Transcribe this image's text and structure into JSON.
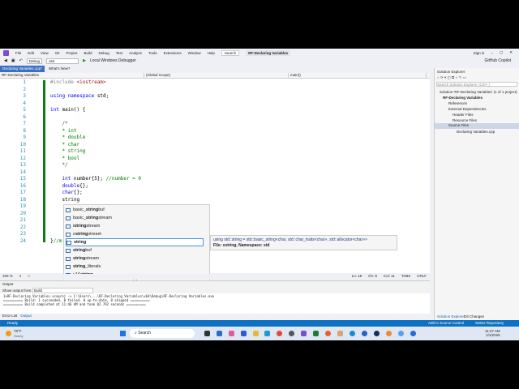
{
  "menu": {
    "items": [
      "File",
      "Edit",
      "View",
      "Git",
      "Project",
      "Build",
      "Debug",
      "Test",
      "Analyze",
      "Tools",
      "Extensions",
      "Window",
      "Help"
    ],
    "search": "Search",
    "project_title": "RF-Declaring Variables",
    "sign_in": "Sign in",
    "copilot": "GitHub Copilot"
  },
  "toolbar": {
    "config": "Debug",
    "platform": "x64",
    "debugger": "Local Windows Debugger"
  },
  "tabs": [
    {
      "label": "Declaring Variables.cpp*"
    },
    {
      "label": "What's New?"
    }
  ],
  "nav": {
    "project": "RF-Declaring Variables",
    "scope": "(Global Scope)",
    "member": "main()"
  },
  "editor": {
    "lines": [
      {
        "n": "1",
        "t": "#include <iostream>"
      },
      {
        "n": "2",
        "t": ""
      },
      {
        "n": "3",
        "t": "using namespace std;"
      },
      {
        "n": "4",
        "t": ""
      },
      {
        "n": "5",
        "t": "int main() {"
      },
      {
        "n": "6",
        "t": ""
      },
      {
        "n": "7",
        "t": "    /*"
      },
      {
        "n": "8",
        "t": "    * int"
      },
      {
        "n": "9",
        "t": "    * double"
      },
      {
        "n": "10",
        "t": "    * char"
      },
      {
        "n": "11",
        "t": "    * string"
      },
      {
        "n": "12",
        "t": "    * bool"
      },
      {
        "n": "13",
        "t": "    */"
      },
      {
        "n": "14",
        "t": ""
      },
      {
        "n": "15",
        "t": "    int number{5}; //number = 0"
      },
      {
        "n": "16",
        "t": "    double{};"
      },
      {
        "n": "17",
        "t": "    char{};"
      },
      {
        "n": "18",
        "t": "    string"
      },
      {
        "n": "19",
        "t": ""
      },
      {
        "n": "20",
        "t": ""
      },
      {
        "n": "21",
        "t": ""
      },
      {
        "n": "22",
        "t": ""
      },
      {
        "n": "23",
        "t": ""
      },
      {
        "n": "24",
        "t": "}//m"
      }
    ]
  },
  "completion": {
    "items": [
      "basic_stringbuf",
      "basic_stringstream",
      "istringstream",
      "ostringstream",
      "string",
      "stringbuf",
      "stringstream",
      "string_literals",
      "u16string"
    ],
    "selected": "string"
  },
  "tooltip": {
    "signature": "using std::string = std::basic_string<char, std::char_traits<char>, std::allocator<char>>",
    "file": "File: xstring, Namespace: std"
  },
  "editor_status": {
    "zoom": "100 %",
    "errors": "2",
    "warnings": "0",
    "ln": "Ln: 18",
    "ch": "Ch: 8",
    "col": "Col: 11",
    "tabs": "TABS",
    "eol": "CRLF"
  },
  "solution_explorer": {
    "title": "Solution Explorer",
    "search_placeholder": "Search Solution Explorer (Ctrl+;)",
    "nodes": [
      "Solution 'RF-Declaring Variables' (1 of 1 project)",
      "RF-Declaring Variables",
      "References",
      "External Dependencies",
      "Header Files",
      "Resource Files",
      "Source Files",
      "Declaring Variables.cpp"
    ],
    "tabs": [
      "Solution Explorer",
      "Git Changes"
    ]
  },
  "output": {
    "title": "Output",
    "show_from_label": "Show output from:",
    "source": "Build",
    "lines": [
      "1>RF-Declaring Variables.vcxproj -> C:\\Users\\...\\RF-Declaring Variables\\x64\\Debug\\RF-Declaring Variables.exe",
      "========== Build: 1 succeeded, 0 failed, 0 up-to-date, 0 skipped ==========",
      "========== Build completed at 11:46 AM and took 02.792 seconds =========="
    ],
    "tabs": [
      "Error List",
      "Output"
    ]
  },
  "status": {
    "ready": "Ready",
    "source_control": "Add to Source Control",
    "repo": "Select Repository"
  },
  "taskbar": {
    "weather_temp": "78°F",
    "weather_desc": "Sunny",
    "search": "Search",
    "time": "11:47 AM",
    "date": "1/1/2026"
  },
  "colors": {
    "accent": "#0e70c0",
    "vs_purple": "#7b4fc9"
  }
}
